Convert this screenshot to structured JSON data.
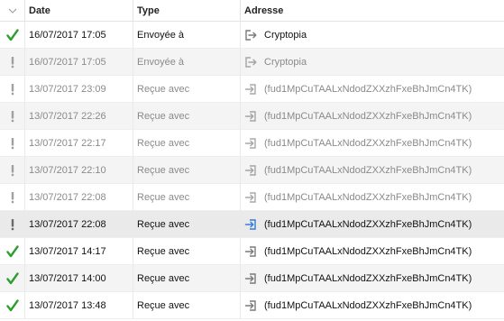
{
  "columns": {
    "date": "Date",
    "type": "Type",
    "address": "Adresse"
  },
  "colors": {
    "confirmed": "#2ca02c",
    "unconfirmed": "#8a8a8a",
    "highlight_icon": "#3a7bd5"
  },
  "rows": [
    {
      "status": "confirmed",
      "date": "16/07/2017 17:05",
      "type": "Envoyée à",
      "icon": "send-arrow-icon",
      "address": "Cryptopia"
    },
    {
      "status": "unconfirmed",
      "date": "16/07/2017 17:05",
      "type": "Envoyée à",
      "icon": "send-arrow-icon",
      "address": "Cryptopia"
    },
    {
      "status": "unconfirmed",
      "date": "13/07/2017 23:09",
      "type": "Reçue avec",
      "icon": "receive-arrow-icon",
      "address": "(fud1MpCuTAALxNdodZXXzhFxeBhJmCn4TK)"
    },
    {
      "status": "unconfirmed",
      "date": "13/07/2017 22:26",
      "type": "Reçue avec",
      "icon": "receive-arrow-icon",
      "address": "(fud1MpCuTAALxNdodZXXzhFxeBhJmCn4TK)"
    },
    {
      "status": "unconfirmed",
      "date": "13/07/2017 22:17",
      "type": "Reçue avec",
      "icon": "receive-arrow-icon",
      "address": "(fud1MpCuTAALxNdodZXXzhFxeBhJmCn4TK)"
    },
    {
      "status": "unconfirmed",
      "date": "13/07/2017 22:10",
      "type": "Reçue avec",
      "icon": "receive-arrow-icon",
      "address": "(fud1MpCuTAALxNdodZXXzhFxeBhJmCn4TK)"
    },
    {
      "status": "unconfirmed",
      "date": "13/07/2017 22:08",
      "type": "Reçue avec",
      "icon": "receive-arrow-icon",
      "address": "(fud1MpCuTAALxNdodZXXzhFxeBhJmCn4TK)"
    },
    {
      "status": "unconfirmed-highlight",
      "date": "13/07/2017 22:08",
      "type": "Reçue avec",
      "icon": "receive-arrow-icon",
      "address": "(fud1MpCuTAALxNdodZXXzhFxeBhJmCn4TK)"
    },
    {
      "status": "confirmed",
      "date": "13/07/2017 14:17",
      "type": "Reçue avec",
      "icon": "receive-arrow-icon",
      "address": "(fud1MpCuTAALxNdodZXXzhFxeBhJmCn4TK)"
    },
    {
      "status": "confirmed",
      "date": "13/07/2017 14:00",
      "type": "Reçue avec",
      "icon": "receive-arrow-icon",
      "address": "(fud1MpCuTAALxNdodZXXzhFxeBhJmCn4TK)"
    },
    {
      "status": "confirmed",
      "date": "13/07/2017 13:48",
      "type": "Reçue avec",
      "icon": "receive-arrow-icon",
      "address": "(fud1MpCuTAALxNdodZXXzhFxeBhJmCn4TK)"
    }
  ]
}
